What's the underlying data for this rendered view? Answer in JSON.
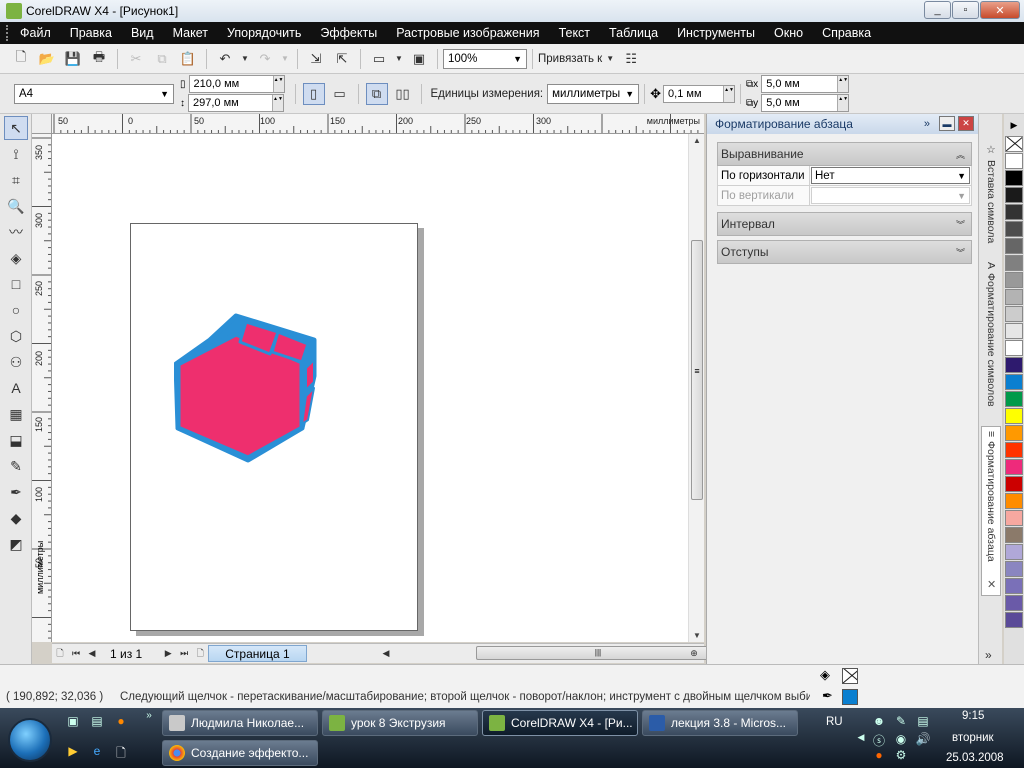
{
  "window": {
    "title": "CorelDRAW X4 - [Рисунок1]",
    "min": "_",
    "max": "▫",
    "close": "✕"
  },
  "menu": [
    "Файл",
    "Правка",
    "Вид",
    "Макет",
    "Упорядочить",
    "Эффекты",
    "Растровые изображения",
    "Текст",
    "Таблица",
    "Инструменты",
    "Окно",
    "Справка"
  ],
  "toolbar1": {
    "zoom": "100%",
    "snap": "Привязать к"
  },
  "toolbar2": {
    "page_size": "A4",
    "width": "210,0 мм",
    "height": "297,0 мм",
    "units_label": "Единицы измерения:",
    "units": "миллиметры",
    "nudge": "0,1 мм",
    "dup_x": "5,0 мм",
    "dup_y": "5,0 мм"
  },
  "ruler": {
    "top_labels": [
      "50",
      "0",
      "50",
      "100",
      "150",
      "200",
      "250",
      "300"
    ],
    "top_unit": "миллиметры",
    "left_labels": [
      "350",
      "300",
      "250",
      "200",
      "150",
      "100",
      "50"
    ],
    "left_unit": "миллиметры"
  },
  "pagenav": {
    "count": "1 из 1",
    "page_tab": "Страница 1"
  },
  "docker": {
    "title": "Форматирование абзаца",
    "alignment_section": "Выравнивание",
    "horizontal_label": "По горизонтали",
    "horizontal_value": "Нет",
    "vertical_label": "По вертикали",
    "vertical_value": "",
    "spacing_section": "Интервал",
    "indents_section": "Отступы"
  },
  "vtabs": [
    "Вставка символа",
    "Форматирование символов",
    "Форматирование абзаца"
  ],
  "palette": [
    "#ffffff",
    "#000000",
    "#1a1a1a",
    "#333333",
    "#4d4d4d",
    "#666666",
    "#808080",
    "#999999",
    "#b3b3b3",
    "#cccccc",
    "#e6e6e6",
    "#ffffff",
    "#2e1a6e",
    "#0a7fd0",
    "#009a4a",
    "#ffff00",
    "#ff9900",
    "#ff3300",
    "#ee2a7b",
    "#cc0000",
    "#ff8c00",
    "#f7a8a0",
    "#8b7a6a",
    "#b0a8d8",
    "#8a86c0",
    "#7a70b8",
    "#6a5aa8",
    "#5a4a98"
  ],
  "status": {
    "coords": "( 190,892; 32,036 )",
    "hint": "Следующий щелчок - перетаскивание/масштабирование; второй щелчок - поворот/наклон; инструмент с двойным щелчком выбира..."
  },
  "taskbar": {
    "tasks_row1": [
      "Людмила Николае...",
      "урок 8  Экструзия",
      "CorelDRAW X4 - [Ри...",
      "лекция 3.8 - Micros..."
    ],
    "tasks_row2": [
      "Создание эффекто..."
    ],
    "lang": "RU",
    "time": "9:15",
    "day": "вторник",
    "date": "25.03.2008"
  },
  "colors": {
    "shape_fill": "#ee2f6e",
    "shape_outline": "#2a8fd6",
    "accent": "#1a3a66"
  }
}
